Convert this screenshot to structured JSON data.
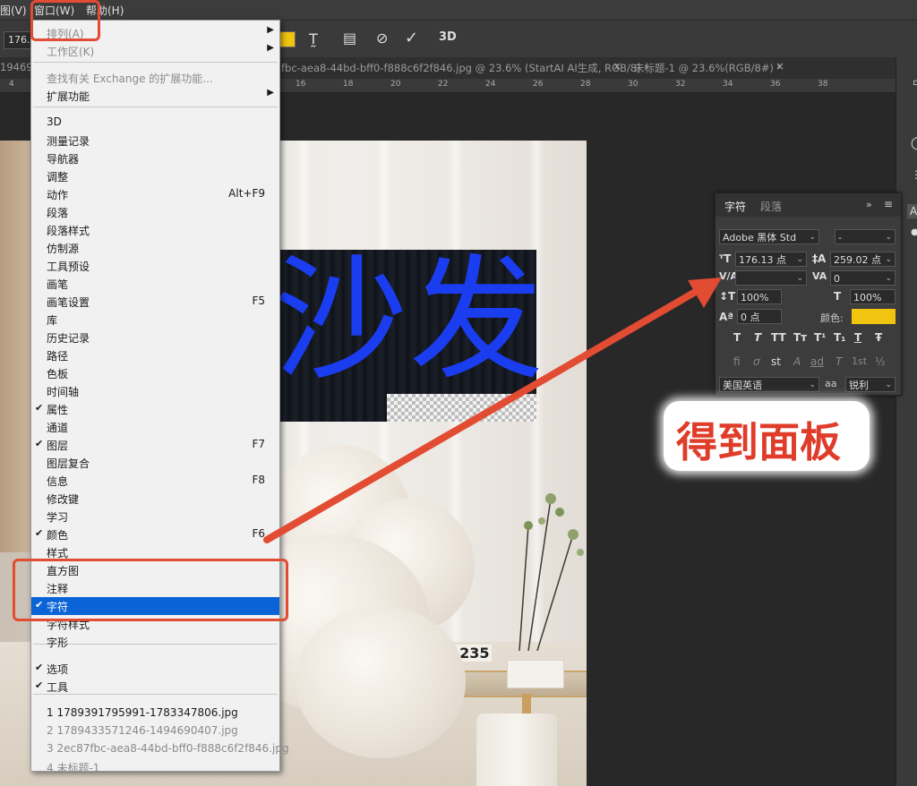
{
  "menubar": {
    "items": [
      {
        "label": "图(V)"
      },
      {
        "label": "窗口(W)"
      },
      {
        "label": "帮助(H)"
      }
    ]
  },
  "options": {
    "size_value": "176.1"
  },
  "tabs": [
    {
      "label": "1946904"
    },
    {
      "label": "fbc-aea8-44bd-bff0-f888c6f2f846.jpg @ 23.6% (StartAI AI生成, RGB/8) *"
    },
    {
      "label": "未标题-1 @ 23.6%(RGB/8#) *"
    }
  ],
  "ruler_numbers": [
    "4",
    "16",
    "18",
    "20",
    "22",
    "24",
    "26",
    "28",
    "30",
    "32",
    "34",
    "36",
    "38"
  ],
  "window_menu": {
    "items": [
      {
        "label": "排列(A)",
        "disabled": true,
        "submenu": true
      },
      {
        "label": "工作区(K)",
        "disabled": true,
        "submenu": true
      },
      {
        "label": "查找有关 Exchange 的扩展功能...",
        "disabled": true
      },
      {
        "label": "扩展功能",
        "submenu": true
      },
      {
        "label": "3D"
      },
      {
        "label": "测量记录"
      },
      {
        "label": "导航器"
      },
      {
        "label": "调整"
      },
      {
        "label": "动作",
        "shortcut": "Alt+F9"
      },
      {
        "label": "段落"
      },
      {
        "label": "段落样式"
      },
      {
        "label": "仿制源"
      },
      {
        "label": "工具预设"
      },
      {
        "label": "画笔"
      },
      {
        "label": "画笔设置",
        "shortcut": "F5"
      },
      {
        "label": "库"
      },
      {
        "label": "历史记录"
      },
      {
        "label": "路径"
      },
      {
        "label": "色板"
      },
      {
        "label": "时间轴"
      },
      {
        "label": "属性",
        "checked": true
      },
      {
        "label": "通道"
      },
      {
        "label": "图层",
        "checked": true,
        "shortcut": "F7"
      },
      {
        "label": "图层复合"
      },
      {
        "label": "信息",
        "shortcut": "F8"
      },
      {
        "label": "修改键"
      },
      {
        "label": "学习"
      },
      {
        "label": "颜色",
        "checked": true,
        "shortcut": "F6"
      },
      {
        "label": "样式"
      },
      {
        "label": "直方图"
      },
      {
        "label": "注释"
      },
      {
        "label": "字符",
        "checked": true,
        "selected": true
      },
      {
        "label": "字符样式"
      },
      {
        "label": "字形"
      },
      {
        "label": "选项",
        "checked": true
      },
      {
        "label": "工具",
        "checked": true
      },
      {
        "label": "1 1789391795991-1783347806.jpg"
      },
      {
        "label": "2 1789433571246-1494690407.jpg",
        "disabled": true
      },
      {
        "label": "3 2ec87fbc-aea8-44bd-bff0-f888c6f2f846.jpg",
        "disabled": true
      },
      {
        "label": "4 未标题-1",
        "disabled": true
      }
    ]
  },
  "canvas": {
    "big_text": "沙发",
    "clock_text": "1235"
  },
  "char_panel": {
    "tab_character": "字符",
    "tab_paragraph": "段落",
    "font_family": "Adobe 黑体 Std",
    "font_style": "-",
    "font_size": "176.13 点",
    "leading": "259.02 点",
    "kerning": "",
    "tracking": "0",
    "vertical_scale": "100%",
    "horizontal_scale": "100%",
    "baseline_shift": "0 点",
    "color_label": "颜色:",
    "color_value": "#f1c40f",
    "language": "美国英语",
    "antialias_label": "aa",
    "antialias": "锐利",
    "style_buttons": [
      "T",
      "T",
      "TT",
      "Tт",
      "T¹",
      "T₁",
      "T",
      "Ŧ"
    ],
    "opentype_buttons": [
      "fi",
      "ơ",
      "st",
      "A",
      "ad",
      "T",
      "1st",
      "½"
    ]
  },
  "annotation": {
    "callout_text": "得到面板",
    "accent_color": "#e24c33"
  }
}
